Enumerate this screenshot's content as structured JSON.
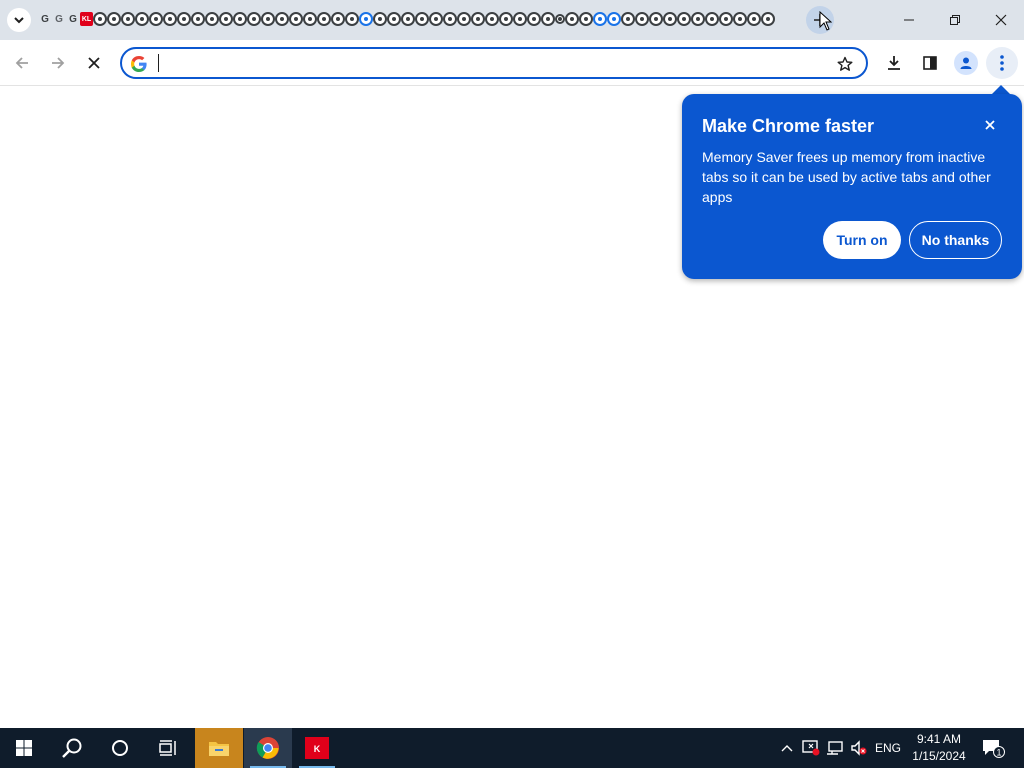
{
  "browser": {
    "tab_strip_label": "Tab search",
    "new_tab_label": "New tab",
    "favicons": [
      {
        "icon": "google-icon",
        "text": "G"
      },
      {
        "icon": "google-grey-icon",
        "text": "G"
      },
      {
        "icon": "google-icon",
        "text": "G"
      },
      {
        "icon": "kl-icon",
        "text": "KL"
      },
      {
        "icon": "globe-icon",
        "count": 19
      },
      {
        "icon": "globe-blue-icon"
      },
      {
        "icon": "globe-icon",
        "count": 13
      },
      {
        "icon": "globe-small-icon"
      },
      {
        "icon": "globe-icon",
        "count": 2
      },
      {
        "icon": "globe-blue-icon",
        "count": 2
      },
      {
        "icon": "globe-icon",
        "count": 11
      }
    ],
    "omnibox": {
      "value": "",
      "placeholder": ""
    },
    "accent_color": "#0b57d0"
  },
  "bubble": {
    "title": "Make Chrome faster",
    "body": "Memory Saver frees up memory from inactive tabs so it can be used by active tabs and other apps",
    "primary_button": "Turn on",
    "secondary_button": "No thanks"
  },
  "taskbar": {
    "language": "ENG",
    "time": "9:41 AM",
    "date": "1/15/2024",
    "notification_count": "1",
    "apps": [
      "file-explorer",
      "chrome",
      "kl-app"
    ]
  }
}
